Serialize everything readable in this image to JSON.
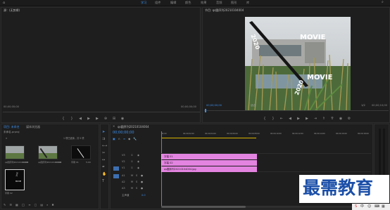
{
  "workspace_tabs": [
    {
      "label": "学习",
      "active": true
    },
    {
      "label": "组件",
      "active": false
    },
    {
      "label": "编辑",
      "active": false
    },
    {
      "label": "颜色",
      "active": false
    },
    {
      "label": "效果",
      "active": false
    },
    {
      "label": "音频",
      "active": false
    },
    {
      "label": "图形",
      "active": false
    },
    {
      "label": "库",
      "active": false
    }
  ],
  "source_panel": {
    "title": "源：(无剪辑)",
    "tc_left": "00;00;00;00",
    "tc_right": "00;00;00;00"
  },
  "program_panel": {
    "title": "节目: qs圆序列20210104004",
    "timecode": "00;00;00;00",
    "fit": "适合",
    "ratio": "1/2",
    "duration": "00;00;10;00",
    "overlay_text": [
      "MOVIE",
      "2020",
      "MOVIE",
      "2020"
    ]
  },
  "project_panel": {
    "tabs": [
      "项目: 未命名",
      "媒体浏览器"
    ],
    "project_name": "未命名.prproj",
    "selection_info": "1 项已选择，共 5 项",
    "items": [
      {
        "name": "qs圆序列20210104004",
        "dur": "10;00"
      },
      {
        "name": "qs圆序列20210104004",
        "dur": "10;00"
      },
      {
        "name": "字幕 01",
        "dur": "5;00"
      },
      {
        "name": "字幕 02",
        "dur": "5;00"
      }
    ]
  },
  "timeline": {
    "tab": "qs圆序列20210104004",
    "timecode": "00;00;00;00",
    "ruler": [
      "00;00",
      "00;00;02;00",
      "00;00;04;00",
      "00;00;06;00",
      "00;00;08;00",
      "00;00;10;00",
      "00;00;12;00",
      "00;00;14;00",
      "00;00;16;00",
      "00;00;18;00"
    ],
    "video_tracks": [
      "V3",
      "V2",
      "V1"
    ],
    "audio_tracks": [
      "A1",
      "A2",
      "A3"
    ],
    "master": "主声道",
    "master_value": "0.0",
    "clips": [
      {
        "label": "字幕 01"
      },
      {
        "label": "字幕 02"
      },
      {
        "label": "qs圆序列20210104004.jpg"
      }
    ]
  },
  "watermark": "最需教育",
  "colors": {
    "accent": "#3d8ee8",
    "clip": "#e384e0"
  }
}
